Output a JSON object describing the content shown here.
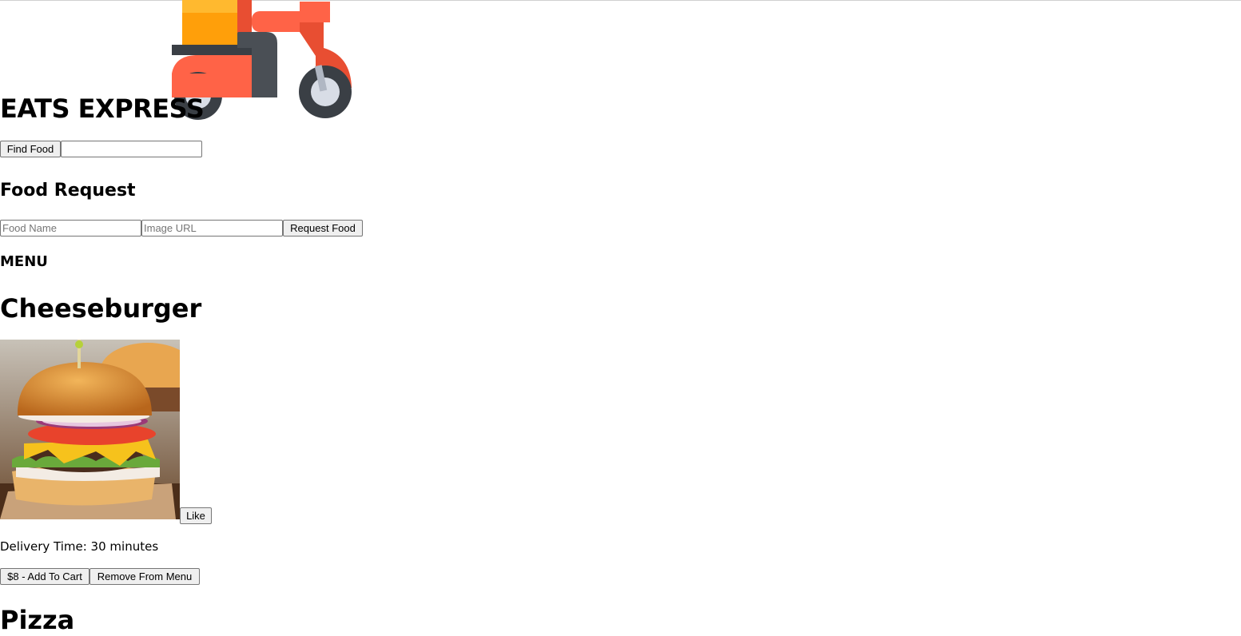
{
  "header": {
    "title": "EATS EXPRESS",
    "logo_icon": "delivery-scooter-icon"
  },
  "search": {
    "button_label": "Find Food",
    "value": "",
    "placeholder": ""
  },
  "request": {
    "heading": "Food Request",
    "name_placeholder": "Food Name",
    "image_placeholder": "Image URL",
    "submit_label": "Request Food"
  },
  "menu": {
    "heading": "MENU",
    "items": [
      {
        "name": "Cheeseburger",
        "like_label": "Like",
        "delivery_text": "Delivery Time: 30 minutes",
        "add_label": "$8 - Add To Cart",
        "remove_label": "Remove From Menu"
      },
      {
        "name": "Pizza"
      }
    ]
  },
  "colors": {
    "scooter_body": "#ff6347",
    "scooter_dark": "#e84e32",
    "box_orange": "#ff9f0a",
    "box_yellow": "#ffb92f",
    "tire": "#3a3f45",
    "rim": "#d8dde6"
  }
}
